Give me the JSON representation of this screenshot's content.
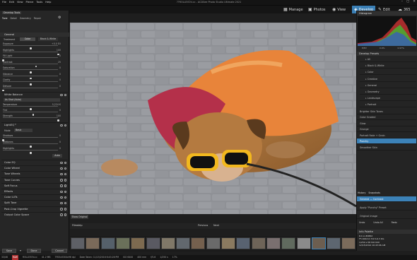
{
  "window": {
    "title": "??ROLLEIS?d.cc - ACDSee Photo Studio Ultimate 2021",
    "menu": [
      "File",
      "Edit",
      "View",
      "Pierce",
      "Tools",
      "Help"
    ]
  },
  "modes": [
    {
      "label": "Manage",
      "icon": "grid-icon"
    },
    {
      "label": "Photos",
      "icon": "photos-icon"
    },
    {
      "label": "View",
      "icon": "eye-icon"
    },
    {
      "label": "Develop",
      "icon": "develop-icon",
      "active": true
    },
    {
      "label": "Edit",
      "icon": "pencil-icon"
    },
    {
      "label": "365",
      "icon": "cloud-icon"
    }
  ],
  "left_panel": {
    "tab_title": "Develop Tools",
    "tabs": [
      "Tune",
      "Detail",
      "Geometry",
      "Repair"
    ],
    "general": {
      "title": "General",
      "treatment_label": "Treatment",
      "treatment_options": [
        "Color",
        "Black & White"
      ],
      "sliders": [
        {
          "label": "Exposure",
          "value": "+0.0 EV",
          "level": 0.5
        },
        {
          "label": "Highlights",
          "value": "100",
          "level": 1.0
        },
        {
          "label": "Fill Light",
          "value": "0",
          "level": 0.0
        },
        {
          "label": "Contrast",
          "value": "25",
          "level": 0.6
        },
        {
          "label": "Saturation",
          "value": "0",
          "level": 0.5
        },
        {
          "label": "Vibrance",
          "value": "0",
          "level": 0.5
        },
        {
          "label": "Clarity",
          "value": "0",
          "level": 0.5
        },
        {
          "label": "Dehaze",
          "value": "0",
          "level": 0.0
        }
      ]
    },
    "white_balance": {
      "title": "White Balance",
      "preset": "As Shot (Auto)",
      "sliders": [
        {
          "label": "Temperature",
          "value": "5,224 K",
          "level": 0.5
        },
        {
          "label": "Tint",
          "value": "0",
          "level": 0.55
        },
        {
          "label": "Strength",
          "value": "100",
          "level": 1.0
        }
      ]
    },
    "lighteq": {
      "title": "LightEQ™",
      "mode_label": "Mode",
      "mode_value": "Basic",
      "sliders": [
        {
          "label": "Shadows",
          "value": "0",
          "level": 0.0
        },
        {
          "label": "Midtones",
          "value": "0",
          "level": 0.5
        },
        {
          "label": "Highlights",
          "value": "0",
          "level": 0.5
        }
      ],
      "auto_label": "Auto"
    },
    "sections": [
      "Color EQ",
      "Color Wheel",
      "Tone Wheels",
      "Tone Curves",
      "Soft Focus",
      "Effects",
      "Color LUTs",
      "Split Tone",
      "Post-Crop Vignette",
      "Output Color Space"
    ],
    "buttons": {
      "save": "Save",
      "done": "Done",
      "cancel": "Cancel"
    }
  },
  "filmstrip": {
    "show_original": "Show Original",
    "label": "Filmstrip",
    "nav": [
      "Previous",
      "Next"
    ]
  },
  "right_panel": {
    "histogram_title": "Histogram",
    "histogram_readout": [
      "E/EV",
      "0.9%",
      "0.97%"
    ],
    "presets_title": "Develop Presets",
    "preset_groups": [
      "All",
      "Black & White",
      "Color",
      "Creative",
      "General",
      "Geometry",
      "Landscape",
      "Portrait"
    ],
    "preset_items": [
      "Brighter Skin Tones",
      "Color Graded",
      "Glow",
      "Grunge",
      "Portrait Fade + Grain",
      "Punchy",
      "Smoother Skin"
    ],
    "selected_preset": "Punchy",
    "history_tabs": [
      "History",
      "Snapshots"
    ],
    "history_items": [
      "General — Contrast",
      "Apply \"Punchy\" Preset",
      "Original Image"
    ],
    "history_buttons": [
      "Undo",
      "Undo All",
      "Redo"
    ],
    "info_title": "Info Palette",
    "info_lines": [
      "R.C.A #0862",
      "F5 400mm f/4.5-6.3 DG",
      "1/250 s   f/8   ISO 640",
      "12/15/2014 10:43:06 AM"
    ]
  },
  "status": {
    "items": [
      "33/46",
      "RAW",
      "ROLLEI5?d.cc",
      "41.2 MB",
      "7953x5304x96 dpi",
      "Date Taken: 11/15/2016 6:43:26 PM",
      "ISO 6400",
      "400 mm",
      "f/5.6",
      "1/250 s",
      "17%"
    ]
  },
  "colors": {
    "accent": "#3c82b8",
    "panel": "#262626",
    "background": "#1e1e1e"
  }
}
